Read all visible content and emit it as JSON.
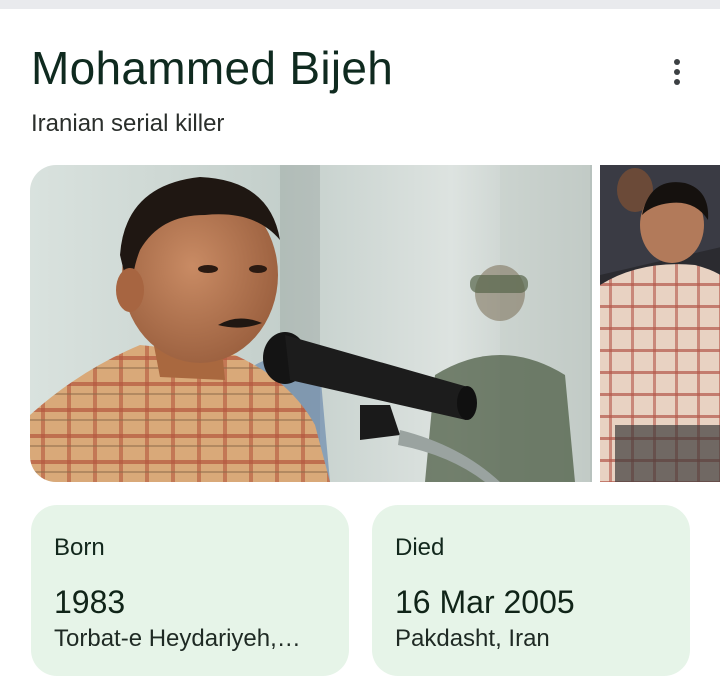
{
  "entity": {
    "name": "Mohammed Bijeh",
    "description": "Iranian serial killer"
  },
  "icons": {
    "menu": "more-vert-icon"
  },
  "images": [
    {
      "name": "trial-photo-microphone"
    },
    {
      "name": "trial-photo-seated"
    }
  ],
  "facts": [
    {
      "label": "Born",
      "value": "1983",
      "detail": "Torbat-e Heydariyeh,…"
    },
    {
      "label": "Died",
      "value": "16 Mar 2005",
      "detail": "Pakdasht, Iran"
    }
  ],
  "colors": {
    "card_background": "#e6f4e8",
    "title_text": "#0f2a1f"
  }
}
